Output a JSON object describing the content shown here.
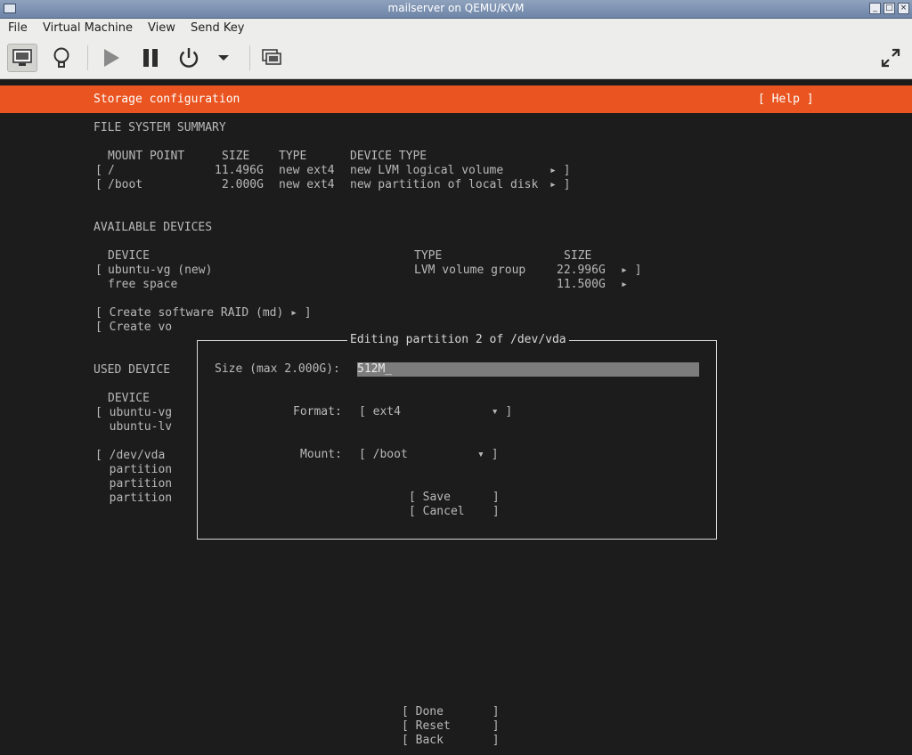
{
  "window": {
    "title": "mailserver on QEMU/KVM"
  },
  "menu": [
    "File",
    "Virtual Machine",
    "View",
    "Send Key"
  ],
  "toolbar": {
    "icons": [
      "console-icon",
      "details-lightbulb-icon",
      "run-play-icon",
      "pause-icon",
      "power-icon",
      "power-dropdown-icon",
      "snapshots-icon",
      "fullscreen-icon"
    ]
  },
  "installer": {
    "header_title": "Storage configuration",
    "help": "[ Help ]",
    "fs_summary": {
      "heading": "FILE SYSTEM SUMMARY",
      "columns": [
        "MOUNT POINT",
        "SIZE",
        "TYPE",
        "DEVICE TYPE"
      ],
      "rows": [
        {
          "open": "[",
          "mount": "/",
          "size": "11.496G",
          "type": "new ext4",
          "device_type": "new LVM logical volume",
          "arrow": "▸ ]"
        },
        {
          "open": "[",
          "mount": "/boot",
          "size": "2.000G",
          "type": "new ext4",
          "device_type": "new partition of local disk",
          "arrow": "▸ ]"
        }
      ]
    },
    "available": {
      "heading": "AVAILABLE DEVICES",
      "columns": [
        "DEVICE",
        "TYPE",
        "SIZE"
      ],
      "rows": [
        {
          "open": "[",
          "device": "ubuntu-vg (new)",
          "type": "LVM volume group",
          "size": "22.996G",
          "arrow": "▸ ]"
        },
        {
          "open": "",
          "device": "free space",
          "type": "",
          "size": "11.500G",
          "arrow": "▸"
        }
      ],
      "create_raid": "[ Create software RAID (md) ▸ ]",
      "create_vo": "[ Create vo"
    },
    "used": {
      "heading": "USED DEVICE",
      "column": "DEVICE",
      "rows": [
        "[ ubuntu-vg",
        "  ubuntu-lv",
        "[ /dev/vda",
        "  partition",
        "  partition",
        "  partition"
      ]
    },
    "dialog": {
      "title": "Editing partition 2 of /dev/vda",
      "size_label": "Size (max 2.000G):",
      "size_value": "512M_",
      "format_label": "Format:",
      "format_value": "[ ext4             ▾ ]",
      "mount_label": "Mount:",
      "mount_value": "[ /boot          ▾ ]",
      "save": "[ Save      ]",
      "cancel": "[ Cancel    ]"
    },
    "bottom_buttons": [
      "[ Done       ]",
      "[ Reset      ]",
      "[ Back       ]"
    ]
  }
}
